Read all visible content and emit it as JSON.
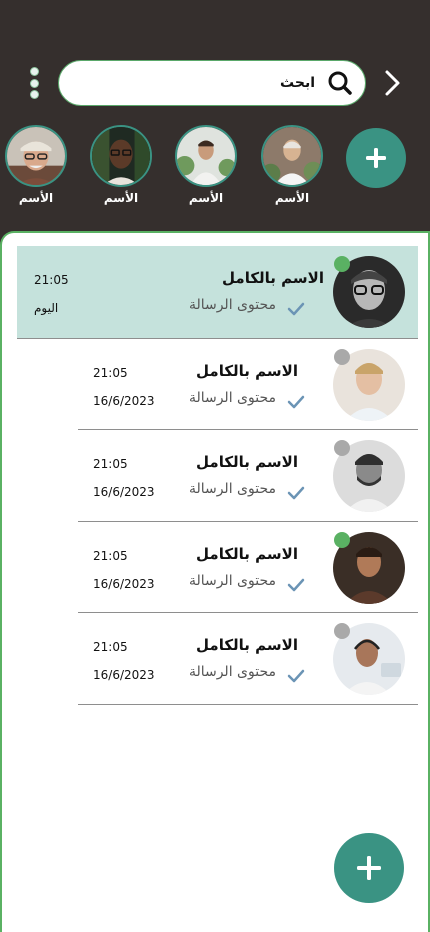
{
  "header": {
    "search_placeholder": "ابحث"
  },
  "stories": [
    {
      "name": "الأسم",
      "avatar": "old-man-cap-avatar"
    },
    {
      "name": "الأسم",
      "avatar": "man-glasses-avatar"
    },
    {
      "name": "الأسم",
      "avatar": "man-plants-avatar"
    },
    {
      "name": "الأسم",
      "avatar": "man-white-shirt-avatar"
    }
  ],
  "chats": [
    {
      "name": "الاسم بالكامل",
      "message": "محتوى الرسالة",
      "time": "21:05",
      "date": "اليوم",
      "status": "online",
      "active": true
    },
    {
      "name": "الاسم بالكامل",
      "message": "محتوى الرسالة",
      "time": "21:05",
      "date": "16/6/2023",
      "status": "offline",
      "active": false
    },
    {
      "name": "الاسم بالكامل",
      "message": "محتوى الرسالة",
      "time": "21:05",
      "date": "16/6/2023",
      "status": "offline",
      "active": false
    },
    {
      "name": "الاسم بالكامل",
      "message": "محتوى الرسالة",
      "time": "21:05",
      "date": "16/6/2023",
      "status": "online",
      "active": false
    },
    {
      "name": "الاسم بالكامل",
      "message": "محتوى الرسالة",
      "time": "21:05",
      "date": "16/6/2023",
      "status": "offline",
      "active": false
    }
  ],
  "colors": {
    "background": "#352f2d",
    "accent": "#3a9383",
    "active_row": "#c5e2dc",
    "online": "#5ab163",
    "offline": "#a9a9a9",
    "check": "#6b94b5"
  },
  "icons": {
    "menu": "vertical-dots-icon",
    "search": "search-icon",
    "back": "chevron-right-icon",
    "add": "plus-icon",
    "read": "check-icon"
  }
}
